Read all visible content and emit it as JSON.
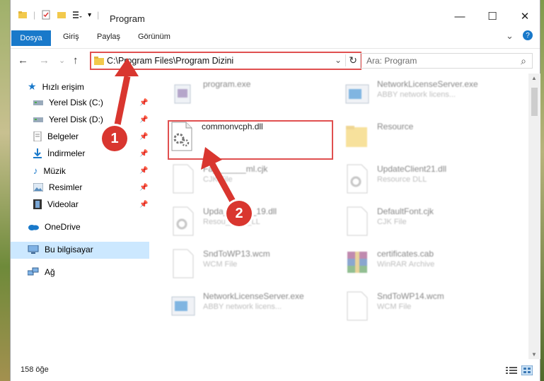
{
  "window": {
    "title": "Program",
    "minimize_glyph": "—",
    "maximize_glyph": "☐",
    "close_glyph": "✕"
  },
  "ribbon": {
    "tabs": [
      "Dosya",
      "Giriş",
      "Paylaş",
      "Görünüm"
    ],
    "expand_glyph": "⌄",
    "help_glyph": "?"
  },
  "address": {
    "path": "C:\\Program Files\\Program Dizini",
    "dropdown_glyph": "⌄",
    "refresh_glyph": "↻",
    "back_glyph": "←",
    "forward_glyph": "→",
    "recent_glyph": "⌄",
    "up_glyph": "↑"
  },
  "search": {
    "placeholder": "Ara: Program",
    "icon_glyph": "⌕"
  },
  "nav": {
    "quick_access": "Hızlı erişim",
    "items": [
      {
        "label": "Yerel Disk (C:)",
        "icon": "drive-icon"
      },
      {
        "label": "Yerel Disk (D:)",
        "icon": "drive-icon"
      },
      {
        "label": "Belgeler",
        "icon": "documents-icon"
      },
      {
        "label": "İndirmeler",
        "icon": "downloads-icon"
      },
      {
        "label": "Müzik",
        "icon": "music-icon"
      },
      {
        "label": "Resimler",
        "icon": "pictures-icon"
      },
      {
        "label": "Videolar",
        "icon": "videos-icon"
      }
    ],
    "onedrive": "OneDrive",
    "this_pc": "Bu bilgisayar",
    "network": "Ağ",
    "pin_glyph": "📌"
  },
  "files": {
    "col1": [
      {
        "name": "program.exe",
        "desc": ""
      },
      {
        "name": "commonvcph.dll",
        "desc": ""
      },
      {
        "name": "Fa_______ml.cjk",
        "desc": "CJK File"
      },
      {
        "name": "Upda_______19.dll",
        "desc": "Resou______LL"
      },
      {
        "name": "SndToWP13.wcm",
        "desc": "WCM File"
      },
      {
        "name": "NetworkLicenseServer.exe",
        "desc": "ABBY network licens..."
      }
    ],
    "col2": [
      {
        "name": "NetworkLicenseServer.exe",
        "desc": "ABBY network licens..."
      },
      {
        "name": "Resource",
        "desc": ""
      },
      {
        "name": "UpdateClient21.dll",
        "desc": "Resource DLL"
      },
      {
        "name": "DefaultFont.cjk",
        "desc": "CJK File"
      },
      {
        "name": "certificates.cab",
        "desc": "WinRAR Archive"
      },
      {
        "name": "SndToWP14.wcm",
        "desc": "WCM File"
      }
    ]
  },
  "status": {
    "count": "158 öğe"
  },
  "annotations": {
    "step1": "1",
    "step2": "2",
    "color": "#d9362f"
  }
}
